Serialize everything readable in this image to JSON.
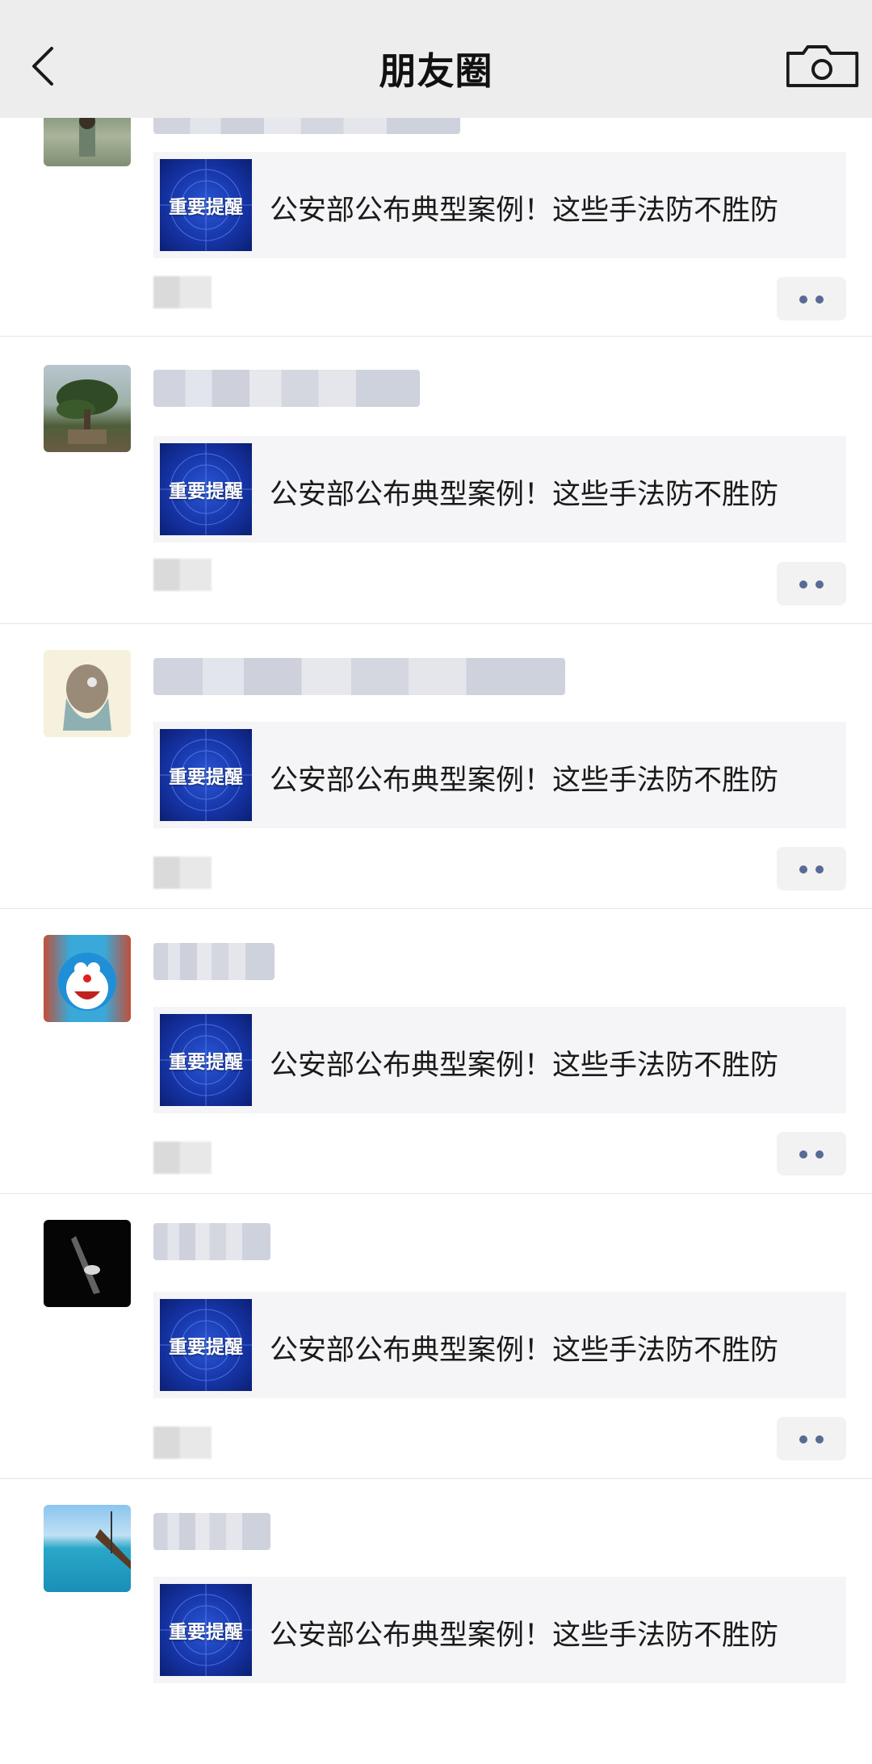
{
  "header": {
    "title": "朋友圈",
    "back_icon": "chevron-left-icon",
    "camera_icon": "camera-icon"
  },
  "link_card": {
    "thumb_label": "重要提醒",
    "title": "公安部公布典型案例！这些手法防不胜防"
  },
  "posts": [
    {
      "avatar": "avatar-person-green-dress",
      "thumb_label": "重要提醒",
      "title": "公安部公布典型案例！这些手法防不胜防"
    },
    {
      "avatar": "avatar-bonsai-tree",
      "thumb_label": "重要提醒",
      "title": "公安部公布典型案例！这些手法防不胜防"
    },
    {
      "avatar": "avatar-anime-girl",
      "thumb_label": "重要提醒",
      "title": "公安部公布典型案例！这些手法防不胜防"
    },
    {
      "avatar": "avatar-doraemon",
      "thumb_label": "重要提醒",
      "title": "公安部公布典型案例！这些手法防不胜防"
    },
    {
      "avatar": "avatar-dark-ring",
      "thumb_label": "重要提醒",
      "title": "公安部公布典型案例！这些手法防不胜防"
    },
    {
      "avatar": "avatar-sea-boat",
      "thumb_label": "重要提醒",
      "title": "公安部公布典型案例！这些手法防不胜防"
    }
  ],
  "colors": {
    "nav_bg": "#ededed",
    "card_bg": "#f5f5f7",
    "link_blue": "#576b95",
    "thumb_blue": "#1635a8"
  }
}
